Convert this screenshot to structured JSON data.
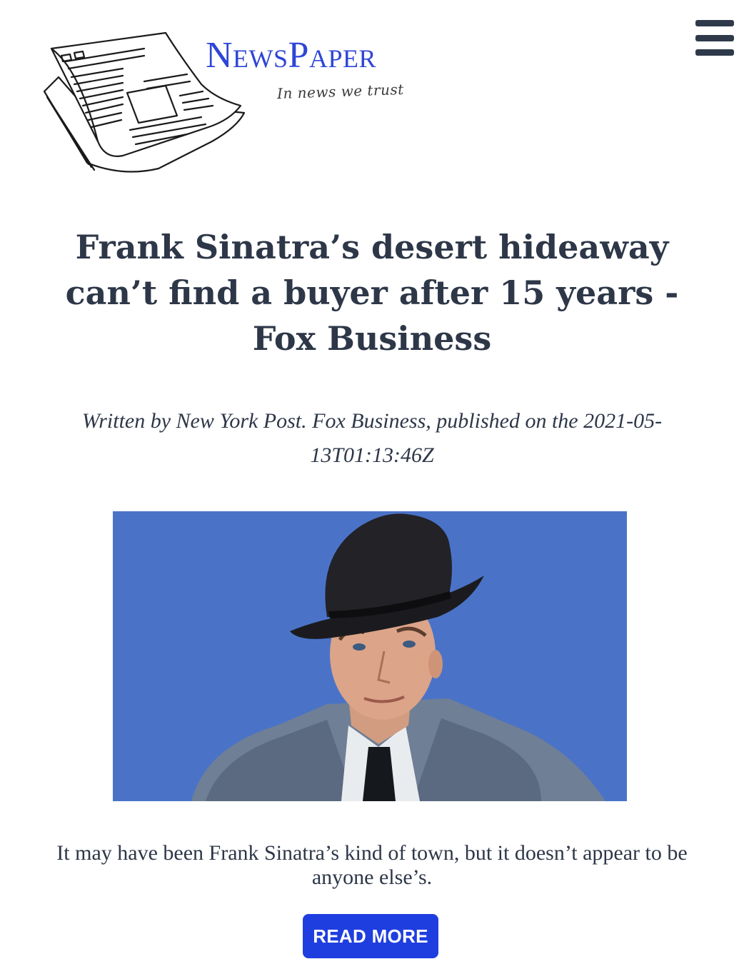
{
  "header": {
    "brand": "NewsPaper",
    "tagline": "In news we trust",
    "menu_icon": "hamburger-menu-icon",
    "logo_icon": "newspaper-icon"
  },
  "article": {
    "title": "Frank Sinatra’s desert hideaway can’t find a buyer after 15 years - Fox Business",
    "byline": "Written by New York Post. Fox Business, published on the 2021-05-13T01:13:46Z",
    "summary": "It may have been Frank Sinatra’s kind of town, but it doesn’t appear to be anyone else’s.",
    "read_more_label": "READ MORE"
  },
  "colors": {
    "brand": "#2f45d6",
    "button": "#1f3ee0",
    "text": "#2d3748",
    "photo_background": "#4a73c8"
  }
}
